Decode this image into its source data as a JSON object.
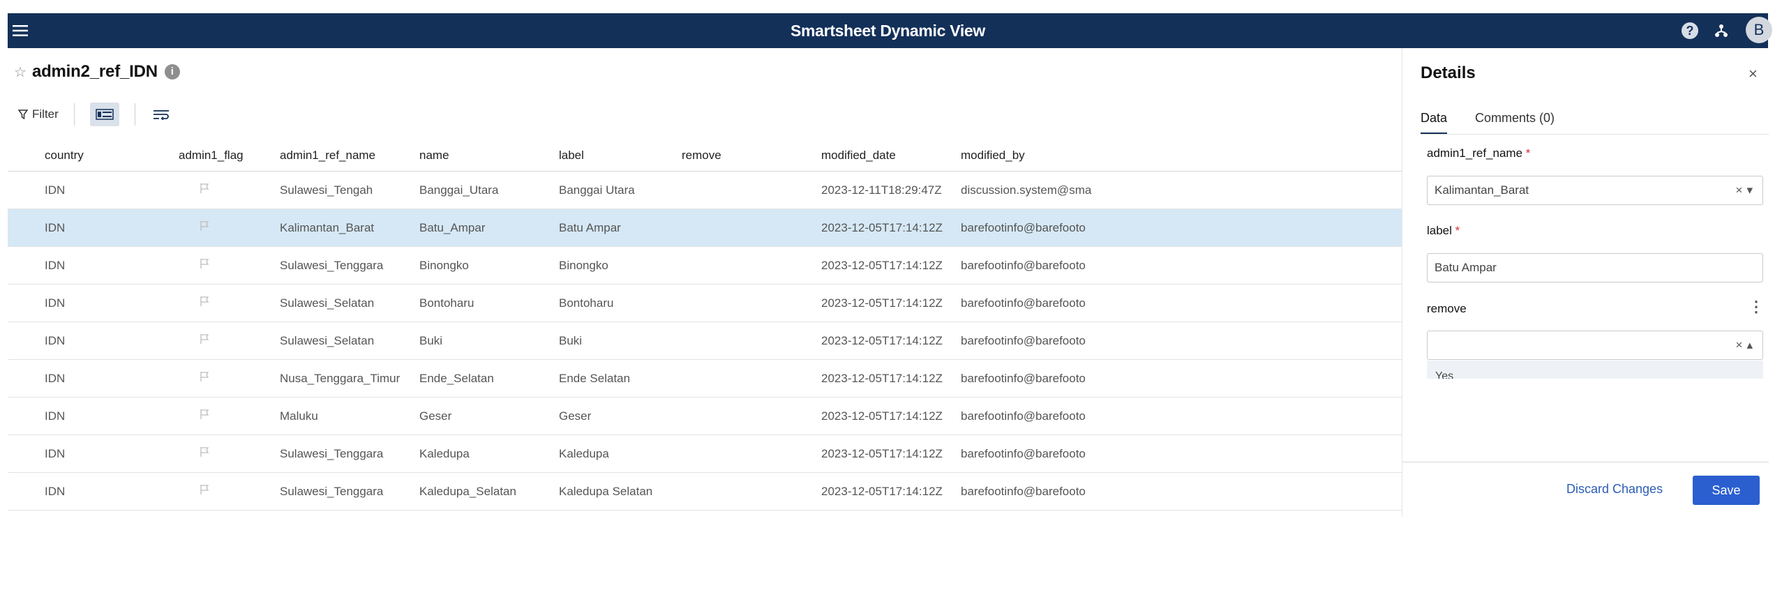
{
  "app": {
    "title": "Smartsheet Dynamic View",
    "avatar_initial": "B",
    "help_glyph": "?"
  },
  "sheet": {
    "name": "admin2_ref_IDN",
    "info_glyph": "i",
    "star_glyph": "☆"
  },
  "toolbar": {
    "filter_label": "Filter"
  },
  "columns": [
    "country",
    "admin1_flag",
    "admin1_ref_name",
    "name",
    "label",
    "remove",
    "modified_date",
    "modified_by"
  ],
  "rows": [
    {
      "country": "IDN",
      "admin1_ref_name": "Sulawesi_Tengah",
      "name": "Banggai_Utara",
      "label": "Banggai Utara",
      "remove": "",
      "modified_date": "2023-12-11T18:29:47Z",
      "modified_by": "discussion.system@sma",
      "selected": false
    },
    {
      "country": "IDN",
      "admin1_ref_name": "Kalimantan_Barat",
      "name": "Batu_Ampar",
      "label": "Batu Ampar",
      "remove": "",
      "modified_date": "2023-12-05T17:14:12Z",
      "modified_by": "barefootinfo@barefooto",
      "selected": true
    },
    {
      "country": "IDN",
      "admin1_ref_name": "Sulawesi_Tenggara",
      "name": "Binongko",
      "label": "Binongko",
      "remove": "",
      "modified_date": "2023-12-05T17:14:12Z",
      "modified_by": "barefootinfo@barefooto",
      "selected": false
    },
    {
      "country": "IDN",
      "admin1_ref_name": "Sulawesi_Selatan",
      "name": "Bontoharu",
      "label": "Bontoharu",
      "remove": "",
      "modified_date": "2023-12-05T17:14:12Z",
      "modified_by": "barefootinfo@barefooto",
      "selected": false
    },
    {
      "country": "IDN",
      "admin1_ref_name": "Sulawesi_Selatan",
      "name": "Buki",
      "label": "Buki",
      "remove": "",
      "modified_date": "2023-12-05T17:14:12Z",
      "modified_by": "barefootinfo@barefooto",
      "selected": false
    },
    {
      "country": "IDN",
      "admin1_ref_name": "Nusa_Tenggara_Timur",
      "name": "Ende_Selatan",
      "label": "Ende Selatan",
      "remove": "",
      "modified_date": "2023-12-05T17:14:12Z",
      "modified_by": "barefootinfo@barefooto",
      "selected": false
    },
    {
      "country": "IDN",
      "admin1_ref_name": "Maluku",
      "name": "Geser",
      "label": "Geser",
      "remove": "",
      "modified_date": "2023-12-05T17:14:12Z",
      "modified_by": "barefootinfo@barefooto",
      "selected": false
    },
    {
      "country": "IDN",
      "admin1_ref_name": "Sulawesi_Tenggara",
      "name": "Kaledupa",
      "label": "Kaledupa",
      "remove": "",
      "modified_date": "2023-12-05T17:14:12Z",
      "modified_by": "barefootinfo@barefooto",
      "selected": false
    },
    {
      "country": "IDN",
      "admin1_ref_name": "Sulawesi_Tenggara",
      "name": "Kaledupa_Selatan",
      "label": "Kaledupa Selatan",
      "remove": "",
      "modified_date": "2023-12-05T17:14:12Z",
      "modified_by": "barefootinfo@barefooto",
      "selected": false
    }
  ],
  "details": {
    "title": "Details",
    "close_glyph": "×",
    "tabs": [
      "Data",
      "Comments (0)"
    ],
    "active_tab": "Data",
    "fields": {
      "admin1_ref_name": {
        "label": "admin1_ref_name",
        "required_mark": "*",
        "value": "Kalimantan_Barat"
      },
      "label": {
        "label": "label",
        "required_mark": "*",
        "value": "Batu Ampar"
      },
      "remove": {
        "label": "remove",
        "value": "",
        "options": [
          "Yes"
        ]
      }
    },
    "clear_glyph": "×",
    "discard_label": "Discard Changes",
    "save_label": "Save"
  },
  "colors": {
    "topbar": "#133059",
    "selected_row": "#d6e8f5",
    "save_button": "#2b5fd0",
    "link": "#2b5cb8"
  }
}
